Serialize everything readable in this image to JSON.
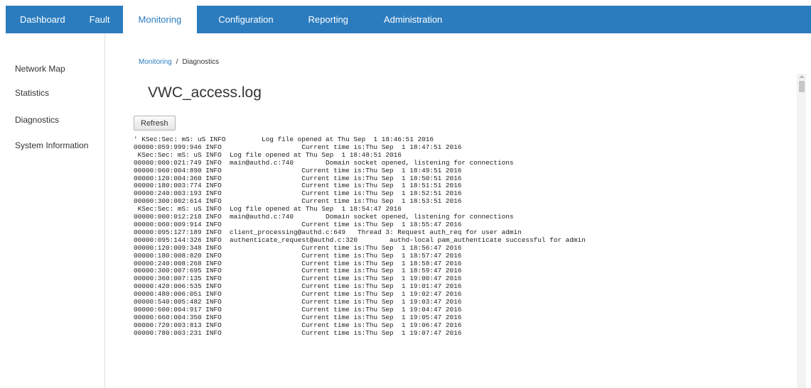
{
  "nav": {
    "tabs": [
      {
        "label": "Dashboard"
      },
      {
        "label": "Fault"
      },
      {
        "label": "Monitoring"
      },
      {
        "label": "Configuration"
      },
      {
        "label": "Reporting"
      },
      {
        "label": "Administration"
      }
    ],
    "active_tab": "Monitoring"
  },
  "sidebar": {
    "items": [
      {
        "label": "Network Map"
      },
      {
        "label": "Statistics"
      },
      {
        "label": "Diagnostics"
      },
      {
        "label": "System Information"
      }
    ]
  },
  "breadcrumb": {
    "parent": "Monitoring",
    "separator": "/",
    "current": "Diagnostics"
  },
  "page": {
    "title": "VWC_access.log",
    "refresh_label": "Refresh"
  },
  "log_lines": [
    "' KSec:Sec: mS: uS INFO         Log file opened at Thu Sep  1 18:46:51 2016",
    "00000:059:999:946 INFO                    Current time is:Thu Sep  1 18:47:51 2016",
    " KSec:Sec: mS: uS INFO  Log file opened at Thu Sep  1 18:48:51 2016",
    "00000:000:021:749 INFO  main@authd.c:740        Domain socket opened, listening for connections",
    "00000:060:004:890 INFO                    Current time is:Thu Sep  1 18:49:51 2016",
    "00000:120:004:360 INFO                    Current time is:Thu Sep  1 18:50:51 2016",
    "00000:180:003:774 INFO                    Current time is:Thu Sep  1 18:51:51 2016",
    "00000:240:003:193 INFO                    Current time is:Thu Sep  1 18:52:51 2016",
    "00000:300:002:614 INFO                    Current time is:Thu Sep  1 18:53:51 2016",
    " KSec:Sec: mS: uS INFO  Log file opened at Thu Sep  1 18:54:47 2016",
    "00000:000:012:218 INFO  main@authd.c:740        Domain socket opened, listening for connections",
    "00000:060:009:914 INFO                    Current time is:Thu Sep  1 18:55:47 2016",
    "00000:095:127:189 INFO  client_processing@authd.c:649   Thread 3: Request auth_req for user admin",
    "00000:095:144:326 INFO  authenticate_request@authd.c:320        authd-local pam_authenticate successful for admin",
    "00000:120:009:348 INFO                    Current time is:Thu Sep  1 18:56:47 2016",
    "00000:180:008:820 INFO                    Current time is:Thu Sep  1 18:57:47 2016",
    "00000:240:008:268 INFO                    Current time is:Thu Sep  1 18:58:47 2016",
    "00000:300:007:695 INFO                    Current time is:Thu Sep  1 18:59:47 2016",
    "00000:360:007:135 INFO                    Current time is:Thu Sep  1 19:00:47 2016",
    "00000:420:006:535 INFO                    Current time is:Thu Sep  1 19:01:47 2016",
    "00000:480:006:051 INFO                    Current time is:Thu Sep  1 19:02:47 2016",
    "00000:540:005:482 INFO                    Current time is:Thu Sep  1 19:03:47 2016",
    "00000:600:004:917 INFO                    Current time is:Thu Sep  1 19:04:47 2016",
    "00000:660:004:350 INFO                    Current time is:Thu Sep  1 19:05:47 2016",
    "00000:720:003:813 INFO                    Current time is:Thu Sep  1 19:06:47 2016",
    "00000:780:003:231 INFO                    Current time is:Thu Sep  1 19:07:47 2016"
  ],
  "colors": {
    "nav_bar": "#2b7cbf",
    "nav_text": "#ffffff",
    "link": "#2b7cbf"
  }
}
